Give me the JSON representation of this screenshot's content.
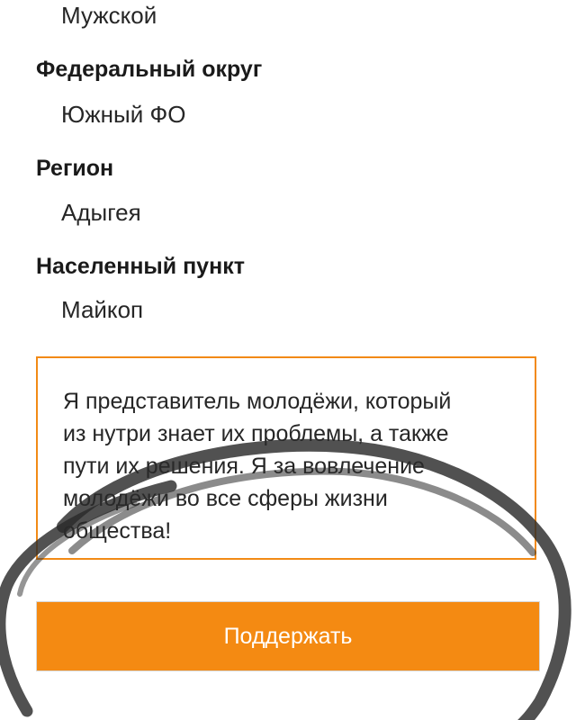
{
  "profile": {
    "gender_value": "Мужской",
    "fields": [
      {
        "label": "Федеральный округ",
        "value": "Южный ФО"
      },
      {
        "label": "Регион",
        "value": "Адыгея"
      },
      {
        "label": "Населенный пункт",
        "value": "Майкоп"
      }
    ]
  },
  "statement": {
    "line1": "Я представитель молодёжи, который",
    "line2": "из нутри знает их проблемы, а также",
    "line3": "пути их решения. Я за вовлечение",
    "line4": "молодёжи во все сферы жизни",
    "line5": "общества!"
  },
  "support_button": {
    "label": "Поддержать"
  },
  "colors": {
    "accent": "#f48a12",
    "box_border": "#f28a16",
    "marker_stroke": "#2b2b2b"
  }
}
